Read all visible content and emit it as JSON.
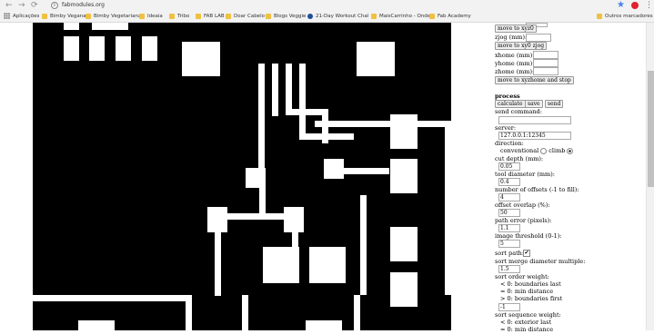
{
  "browser": {
    "url": "fabmodules.org",
    "back_glyph": "←",
    "forward_glyph": "→",
    "reload_glyph": "⟳",
    "star_glyph": "★",
    "menu_glyph": "⋮",
    "bookmarks": [
      {
        "label": "Aplicações",
        "icon": "apps-icon"
      },
      {
        "label": "Bimby Vegana",
        "icon": "bookmark-icon"
      },
      {
        "label": "Bimby Vegetariana",
        "icon": "bookmark-icon"
      },
      {
        "label": "Ideaia",
        "icon": "bookmark-icon"
      },
      {
        "label": "Tribo",
        "icon": "bookmark-icon"
      },
      {
        "label": "FAB LAB",
        "icon": "bookmark-icon"
      },
      {
        "label": "Doar Cabelo",
        "icon": "bookmark-icon"
      },
      {
        "label": "Blogs Veggie",
        "icon": "bookmark-icon"
      },
      {
        "label": "21-Day Workout Chal",
        "icon": "site-icon"
      },
      {
        "label": "MaisCarrinho - Onde",
        "icon": "bookmark-icon"
      },
      {
        "label": "Fab Academy",
        "icon": "bookmark-icon"
      },
      {
        "label": "Outros marcadores",
        "icon": "folder-icon"
      }
    ]
  },
  "panel": {
    "move_xyz0": "move to xyz0",
    "zjog_label": "zjog (mm):",
    "move_xy0_zjog": "move to xy0 zjog",
    "xhome_label": "xhome (mm):",
    "yhome_label": "yhome (mm):",
    "zhome_label": "zhome (mm):",
    "move_home": "move to xyzhome and stop",
    "process_title": "process",
    "calculate": "calculate",
    "save": "save",
    "send": "send",
    "send_command_label": "send command:",
    "server_label": "server:",
    "server_value": "127.0.0.1:12345",
    "direction_label": "direction:",
    "conventional_label": "conventional",
    "climb_label": "climb",
    "cut_depth_label": "cut depth (mm):",
    "cut_depth_value": "0.05",
    "tool_diameter_label": "tool diameter (mm):",
    "tool_diameter_value": "0.4",
    "offsets_label": "number of offsets (-1 to fill):",
    "offsets_value": "4",
    "overlap_label": "offset overlap (%):",
    "overlap_value": "50",
    "path_error_label": "path error (pixels):",
    "path_error_value": "1.1",
    "threshold_label": "image threshold (0-1):",
    "threshold_value": "5",
    "sort_path_label": "sort path:",
    "sort_path_check": "✔",
    "merge_label": "sort merge diameter multiple:",
    "merge_value": "1.5",
    "order_weight_label": "sort order weight:",
    "order_lt": "< 0: boundaries last",
    "order_eq": "= 0: min distance",
    "order_gt": "> 0: boundaries first",
    "order_value": "-1",
    "sequence_weight_label": "sort sequence weight:",
    "sequence_lt": "< 0: exterior last",
    "sequence_eq": "= 0: min distance"
  }
}
